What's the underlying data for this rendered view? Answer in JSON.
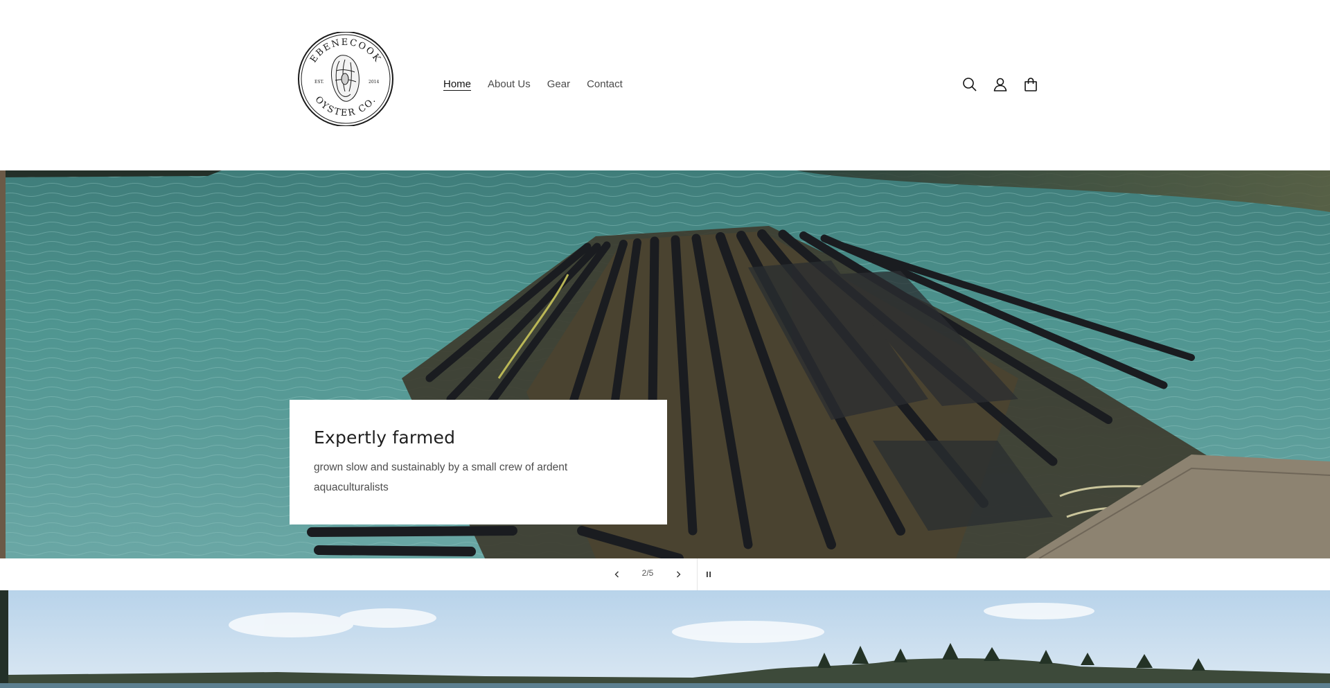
{
  "header": {
    "logo": {
      "top_text": "EBENECOOK",
      "bottom_text": "OYSTER CO.",
      "left_text": "EST.",
      "right_text": "2014"
    },
    "nav": [
      {
        "label": "Home",
        "active": true
      },
      {
        "label": "About Us",
        "active": false
      },
      {
        "label": "Gear",
        "active": false
      },
      {
        "label": "Contact",
        "active": false
      }
    ],
    "icons": [
      "search-icon",
      "account-icon",
      "cart-icon"
    ]
  },
  "slideshow": {
    "caption_title": "Expertly farmed",
    "caption_text": "grown slow and sustainably by a small crew of ardent aquaculturalists",
    "counter": "2/5",
    "current": 2,
    "total": 5
  },
  "colors": {
    "water": "#4d8f8f",
    "accent_text": "#121212"
  }
}
